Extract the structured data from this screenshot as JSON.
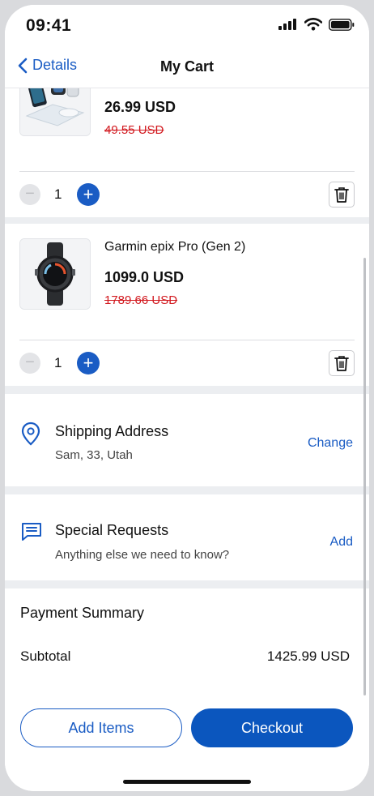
{
  "status_bar": {
    "time": "09:41"
  },
  "nav": {
    "back_label": "Details",
    "title": "My Cart"
  },
  "cart": {
    "items": [
      {
        "name": "",
        "price": "26.99 USD",
        "original_price": "49.55 USD",
        "quantity": "1"
      },
      {
        "name": "Garmin epix Pro (Gen 2)",
        "price": "1099.0 USD",
        "original_price": "1789.66 USD",
        "quantity": "1"
      }
    ]
  },
  "shipping": {
    "title": "Shipping Address",
    "address": "Sam, 33, Utah",
    "action": "Change"
  },
  "requests": {
    "title": "Special Requests",
    "placeholder": "Anything else we need to know?",
    "action": "Add"
  },
  "payment": {
    "title": "Payment Summary",
    "subtotal_label": "Subtotal",
    "subtotal_value": "1425.99 USD"
  },
  "footer": {
    "add_items_label": "Add Items",
    "checkout_label": "Checkout"
  },
  "colors": {
    "accent": "#1a5cc4",
    "discount": "#d2191f"
  }
}
